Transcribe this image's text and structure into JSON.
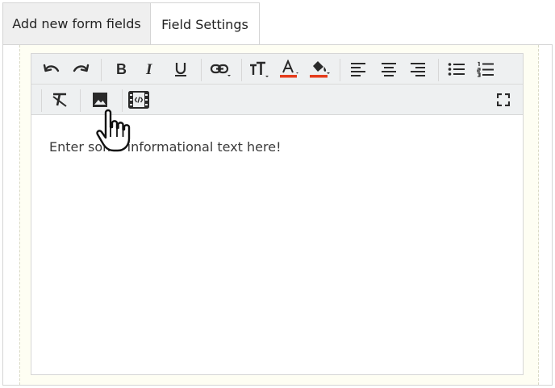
{
  "tabs": [
    {
      "label": "Add new form fields"
    },
    {
      "label": "Field Settings"
    }
  ],
  "editor": {
    "content_text": "Enter some informational text here!"
  },
  "colors": {
    "text_color_underline": "#e53d1d",
    "fill_color_underline": "#e53d1d",
    "panel_background": "#fefef3",
    "toolbar_background": "#eef0f1"
  },
  "toolbar": {
    "row1": [
      "undo-icon",
      "redo-icon",
      "bold-icon",
      "italic-icon",
      "underline-icon",
      "link-icon",
      "font-size-icon",
      "text-color-icon",
      "fill-color-icon",
      "align-left-icon",
      "align-center-icon",
      "align-right-icon",
      "bullet-list-icon",
      "numbered-list-icon"
    ],
    "row2": [
      "clear-format-icon",
      "insert-image-icon",
      "insert-video-icon",
      "fullscreen-icon"
    ]
  }
}
